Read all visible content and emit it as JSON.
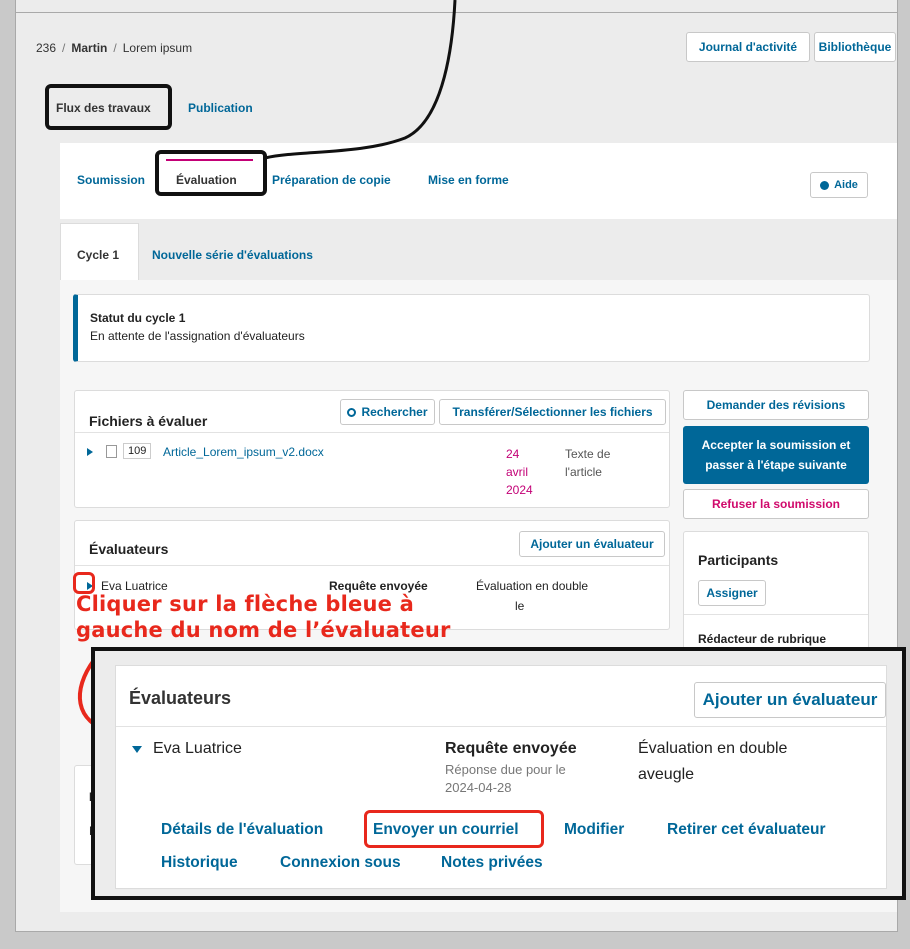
{
  "breadcrumb": {
    "id": "236",
    "author": "Martin",
    "title": "Lorem ipsum"
  },
  "header_buttons": {
    "activity_log": "Journal d'activité",
    "library": "Bibliothèque"
  },
  "main_tabs": {
    "workflow": "Flux des travaux",
    "publication": "Publication"
  },
  "stage_tabs": {
    "submission": "Soumission",
    "review": "Évaluation",
    "copyediting": "Préparation de copie",
    "production": "Mise en forme",
    "help": "Aide"
  },
  "round_tabs": {
    "round1": "Cycle 1",
    "new_round": "Nouvelle série d'évaluations"
  },
  "status": {
    "title": "Statut du cycle 1",
    "text": "En attente de l'assignation d'évaluateurs"
  },
  "files": {
    "title": "Fichiers à évaluer",
    "search": "Rechercher",
    "upload": "Transférer/Sélectionner les fichiers",
    "row": {
      "id": "109",
      "name": "Article_Lorem_ipsum_v2.docx",
      "date_day": "24",
      "date_month": "avril",
      "date_year": "2024",
      "type_line1": "Texte de",
      "type_line2": "l'article"
    }
  },
  "decisions": {
    "revisions": "Demander des révisions",
    "accept_line1": "Accepter la soumission et",
    "accept_line2": "passer à l'étape suivante",
    "decline": "Refuser la soumission"
  },
  "reviewers": {
    "title": "Évaluateurs",
    "add": "Ajouter un évaluateur",
    "name": "Eva Luatrice",
    "status": "Requête envoyée",
    "method_line1": "Évaluation en double",
    "method_fragment": "le",
    "due": "Réponse due pour le",
    "due_date": "2024-04-28",
    "method_line2": "aveugle"
  },
  "participants": {
    "title": "Participants",
    "assign": "Assigner",
    "role": "Rédacteur de rubrique"
  },
  "annotation": {
    "line1": "Cliquer sur la flèche bleue à",
    "line2": "gauche du nom de l’évaluateur"
  },
  "actions": {
    "details": "Détails de l'évaluation",
    "email": "Envoyer un courriel",
    "edit": "Modifier",
    "remove": "Retirer cet évaluateur",
    "history": "Historique",
    "login_as": "Connexion sous",
    "notes": "Notes privées"
  },
  "hidden_fragments": {
    "a": "N",
    "b": "I"
  },
  "colors": {
    "primary": "#006798",
    "accept_bg": "#006798",
    "decline": "#d00a6c",
    "annotation": "#e8281c",
    "tab_highlight": "#c30076"
  }
}
